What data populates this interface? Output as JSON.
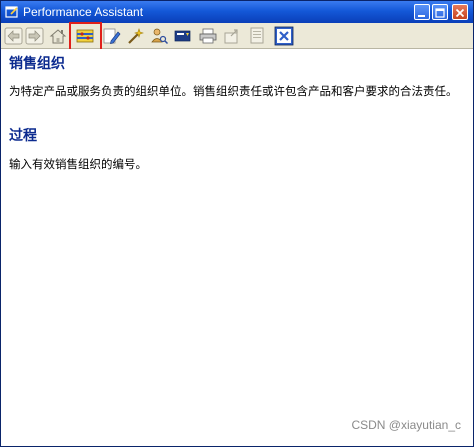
{
  "window": {
    "title": "Performance Assistant"
  },
  "toolbar": {
    "buttons": [
      {
        "icon": "back-arrow-icon"
      },
      {
        "icon": "forward-arrow-icon"
      },
      {
        "icon": "home-icon"
      },
      {
        "icon": "technical-info-icon",
        "highlighted": true
      },
      {
        "icon": "edit-pencil-icon"
      },
      {
        "icon": "magic-wand-icon"
      },
      {
        "icon": "person-search-icon"
      },
      {
        "icon": "comment-icon"
      },
      {
        "icon": "print-icon"
      },
      {
        "icon": "export-icon"
      },
      {
        "icon": "document-icon"
      },
      {
        "icon": "close-icon"
      }
    ],
    "highlight_color": "#e0201b"
  },
  "content": {
    "section1_heading": "销售组织",
    "section1_text": "为特定产品或服务负责的组织单位。销售组织责任或许包含产品和客户要求的合法责任。",
    "section2_heading": "过程",
    "section2_text": "输入有效销售组织的编号。"
  },
  "watermark": "CSDN @xiayutian_c",
  "colors": {
    "titlebar": "#1458d8",
    "heading": "#0b2a8f",
    "toolbar_bg": "#ece9d8"
  }
}
